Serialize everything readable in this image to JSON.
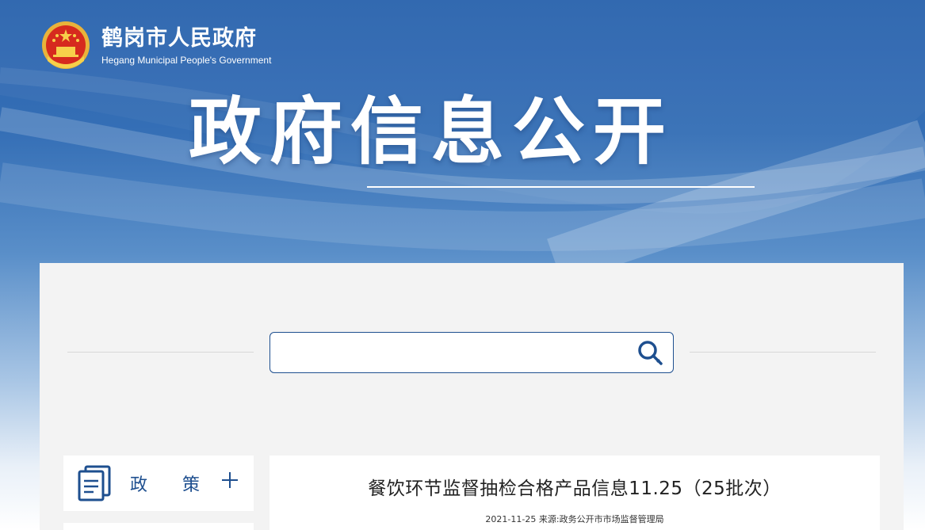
{
  "header": {
    "site_name_cn": "鹤岗市人民政府",
    "site_name_en": "Hegang Municipal People's Government",
    "banner_title": "政府信息公开"
  },
  "search": {
    "placeholder": "",
    "value": ""
  },
  "sidebar": {
    "items": [
      {
        "label": "政策",
        "icon": "document-icon",
        "expand_icon": "plus-icon"
      }
    ]
  },
  "article": {
    "title": "餐饮环节监督抽检合格产品信息11.25（25批次）",
    "date": "2021-11-25",
    "source_label": "来源:",
    "source": "政务公开市市场监督管理局"
  },
  "colors": {
    "header_blue": "#2a63ad",
    "accent_blue": "#1e4f8f",
    "content_bg": "#f3f3f3"
  }
}
